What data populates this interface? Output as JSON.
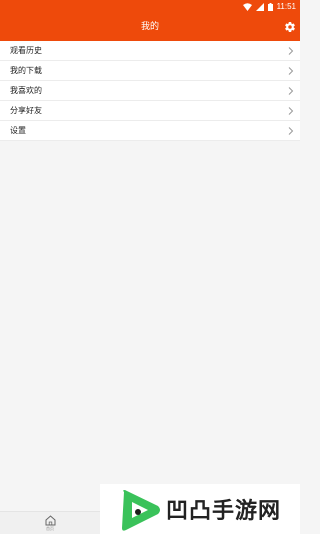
{
  "status_bar": {
    "time": "11:51"
  },
  "app_bar": {
    "title": "我的"
  },
  "menu": {
    "items": [
      {
        "label": "观看历史"
      },
      {
        "label": "我的下载"
      },
      {
        "label": "我喜欢的"
      },
      {
        "label": "分享好友"
      },
      {
        "label": "设置"
      }
    ]
  },
  "bottom_nav": {
    "home_label": "首页"
  },
  "watermark": {
    "text": "凹凸手游网"
  },
  "colors": {
    "brand": "#ee4a0b",
    "watermark_green": "#3ac25a"
  }
}
